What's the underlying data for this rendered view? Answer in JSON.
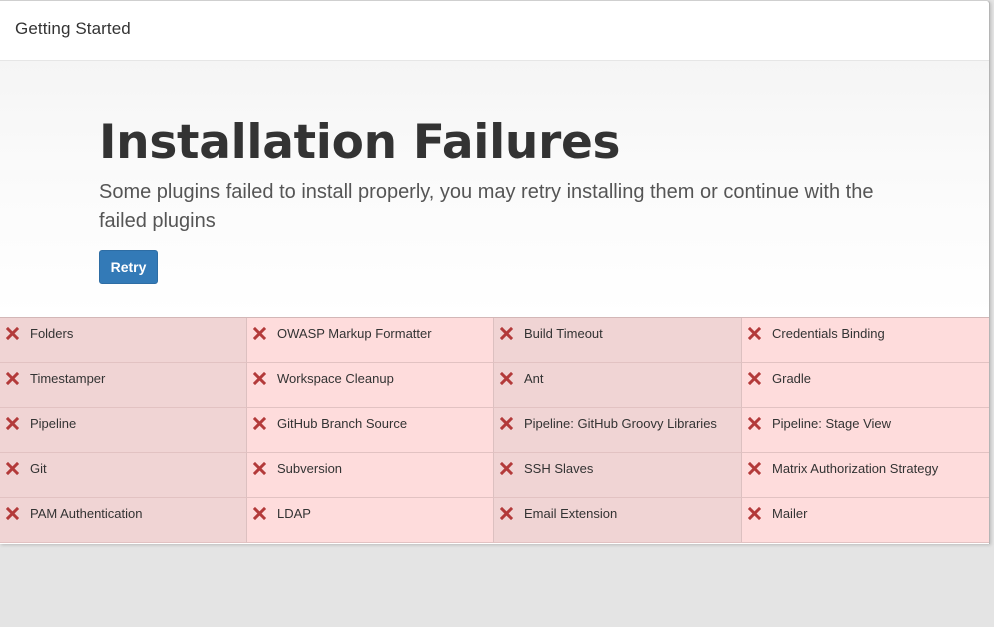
{
  "header": {
    "title": "Getting Started"
  },
  "hero": {
    "title": "Installation Failures",
    "description": "Some plugins failed to install properly, you may retry installing them or continue with the failed plugins",
    "retry_label": "Retry"
  },
  "colors": {
    "failure_bg": "#fedcdc",
    "failure_bg_alt": "#f0d4d4",
    "icon": "#b33a3a",
    "button": "#337ab7"
  },
  "plugins": [
    {
      "name": "Folders",
      "status": "failed",
      "icon": "x-icon"
    },
    {
      "name": "OWASP Markup Formatter",
      "status": "failed",
      "icon": "x-icon"
    },
    {
      "name": "Build Timeout",
      "status": "failed",
      "icon": "x-icon"
    },
    {
      "name": "Credentials Binding",
      "status": "failed",
      "icon": "x-icon"
    },
    {
      "name": "Timestamper",
      "status": "failed",
      "icon": "x-icon"
    },
    {
      "name": "Workspace Cleanup",
      "status": "failed",
      "icon": "x-icon"
    },
    {
      "name": "Ant",
      "status": "failed",
      "icon": "x-icon"
    },
    {
      "name": "Gradle",
      "status": "failed",
      "icon": "x-icon"
    },
    {
      "name": "Pipeline",
      "status": "failed",
      "icon": "x-icon"
    },
    {
      "name": "GitHub Branch Source",
      "status": "failed",
      "icon": "x-icon"
    },
    {
      "name": "Pipeline: GitHub Groovy Libraries",
      "status": "failed",
      "icon": "x-icon"
    },
    {
      "name": "Pipeline: Stage View",
      "status": "failed",
      "icon": "x-icon"
    },
    {
      "name": "Git",
      "status": "failed",
      "icon": "x-icon"
    },
    {
      "name": "Subversion",
      "status": "failed",
      "icon": "x-icon"
    },
    {
      "name": "SSH Slaves",
      "status": "failed",
      "icon": "x-icon"
    },
    {
      "name": "Matrix Authorization Strategy",
      "status": "failed",
      "icon": "x-icon"
    },
    {
      "name": "PAM Authentication",
      "status": "failed",
      "icon": "x-icon"
    },
    {
      "name": "LDAP",
      "status": "failed",
      "icon": "x-icon"
    },
    {
      "name": "Email Extension",
      "status": "failed",
      "icon": "x-icon"
    },
    {
      "name": "Mailer",
      "status": "failed",
      "icon": "x-icon"
    }
  ]
}
